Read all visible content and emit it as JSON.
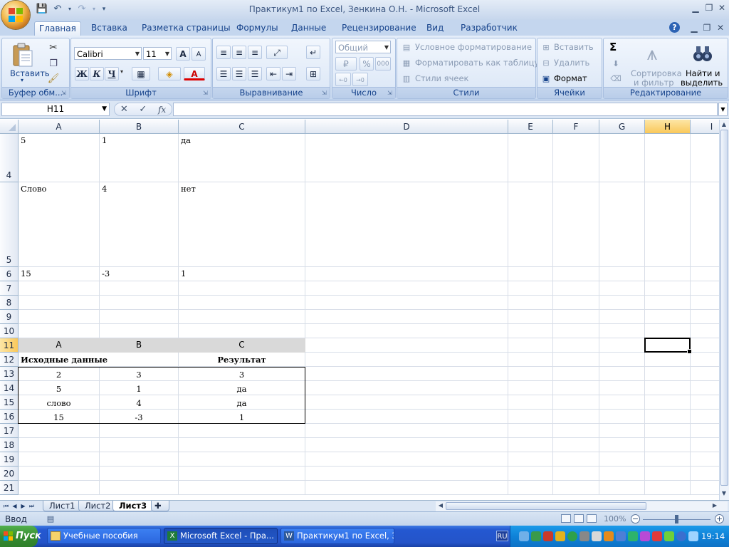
{
  "window": {
    "title": "Практикум1 по Excel, Зенкина О.Н. - Microsoft Excel"
  },
  "ribbon": {
    "tabs": [
      "Главная",
      "Вставка",
      "Разметка страницы",
      "Формулы",
      "Данные",
      "Рецензирование",
      "Вид",
      "Разработчик"
    ],
    "clipboard": {
      "paste": "Вставить",
      "label": "Буфер обм..."
    },
    "font": {
      "name": "Calibri",
      "size": "11",
      "label": "Шрифт",
      "bold": "Ж",
      "italic": "К",
      "underline": "Ч",
      "grow": "A",
      "shrink": "A",
      "color": "A"
    },
    "alignment": {
      "label": "Выравнивание"
    },
    "number": {
      "format": "Общий",
      "percent": "%",
      "thousands": "000",
      "label": "Число"
    },
    "styles": {
      "conditional": "Условное форматирование",
      "as_table": "Форматировать как таблицу",
      "cell_styles": "Стили ячеек",
      "label": "Стили"
    },
    "cells": {
      "insert": "Вставить",
      "delete": "Удалить",
      "format": "Формат",
      "label": "Ячейки"
    },
    "editing": {
      "sigma": "Σ",
      "sort_line1": "Сортировка",
      "sort_line2": "и фильтр",
      "find_line1": "Найти и",
      "find_line2": "выделить",
      "label": "Редактирование"
    }
  },
  "formula_bar": {
    "name_box": "H11",
    "fx": "fx",
    "value": ""
  },
  "sheet": {
    "columns": [
      "A",
      "B",
      "C",
      "D",
      "E",
      "F",
      "G",
      "H",
      "I"
    ],
    "selected_column": "H",
    "selected_row": "11",
    "rows": [
      "4",
      "5",
      "6",
      "7",
      "8",
      "9",
      "10",
      "11",
      "12",
      "13",
      "14",
      "15",
      "16",
      "17",
      "18",
      "19",
      "20",
      "21"
    ],
    "top_table": [
      [
        "5",
        "1",
        "да"
      ],
      [
        "Слово",
        "4",
        "нет"
      ],
      [
        "15",
        "-3",
        "1"
      ]
    ],
    "result_header": [
      "A",
      "B",
      "C"
    ],
    "result_titles": {
      "source": "Исходные данные",
      "result": "Результат"
    },
    "result_table": [
      [
        "2",
        "3",
        "3"
      ],
      [
        "5",
        "1",
        "да"
      ],
      [
        "слово",
        "4",
        "да"
      ],
      [
        "15",
        "-3",
        "1"
      ]
    ]
  },
  "sheet_tabs": [
    "Лист1",
    "Лист2",
    "Лист3"
  ],
  "active_sheet": "Лист3",
  "status": {
    "mode": "Ввод",
    "zoom": "100%"
  },
  "taskbar": {
    "start": "Пуск",
    "tasks": [
      "Учебные пособия",
      "Microsoft Excel - Пра...",
      "Практикум1 по Excel, З..."
    ],
    "lang": "RU",
    "clock": "19:14"
  }
}
